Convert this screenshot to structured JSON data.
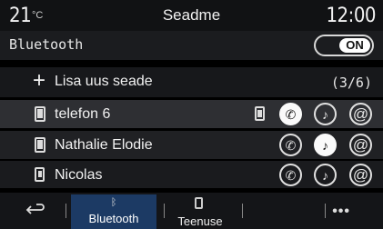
{
  "status": {
    "temperature": "21",
    "temperature_unit": "°C",
    "title": "Seadme",
    "time": "12:00"
  },
  "bluetooth": {
    "label": "Bluetooth",
    "toggle": "ON"
  },
  "add_device": {
    "plus": "+",
    "label": "Lisa uus seade",
    "count": "(3/6)"
  },
  "devices": [
    {
      "name": "telefon 6",
      "icon": "phone-icon",
      "call": "phone-icon",
      "music": "music-note-icon",
      "messages": "at-icon"
    },
    {
      "name": "Nathalie Elodie",
      "icon": "phone-icon",
      "call": "phone-icon",
      "music": "music-note-icon",
      "messages": "at-icon"
    },
    {
      "name": "Nicolas",
      "icon": "phone-icon",
      "call": "phone-icon",
      "music": "music-note-icon",
      "messages": "at-icon"
    }
  ],
  "glyphs": {
    "call": "✆",
    "music": "♪",
    "at": "@",
    "bt": "ᛒ"
  },
  "bottom_nav": {
    "tab_bluetooth": "Bluetooth",
    "tab_services": "Teenuse",
    "more": "•••"
  },
  "colors": {
    "accent_tab": "#1c3a64",
    "background": "#000000"
  }
}
